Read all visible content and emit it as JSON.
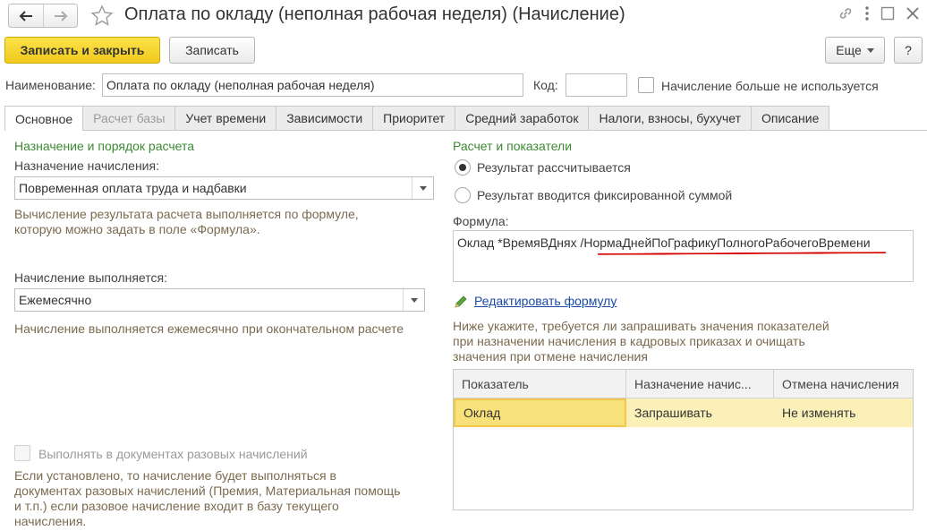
{
  "window": {
    "title": "Оплата по окладу (неполная рабочая неделя) (Начисление)"
  },
  "toolbar": {
    "save_close_label": "Записать и закрыть",
    "save_label": "Записать",
    "more_label": "Еще",
    "help_label": "?"
  },
  "header": {
    "name_label": "Наименование:",
    "name_value": "Оплата по окладу (неполная рабочая неделя)",
    "code_label": "Код:",
    "code_value": "",
    "unused_label": "Начисление больше не используется"
  },
  "tabs": [
    {
      "label": "Основное",
      "state": "active"
    },
    {
      "label": "Расчет базы",
      "state": "disabled"
    },
    {
      "label": "Учет времени",
      "state": "normal"
    },
    {
      "label": "Зависимости",
      "state": "normal"
    },
    {
      "label": "Приоритет",
      "state": "normal"
    },
    {
      "label": "Средний заработок",
      "state": "normal"
    },
    {
      "label": "Налоги, взносы, бухучет",
      "state": "normal"
    },
    {
      "label": "Описание",
      "state": "normal"
    }
  ],
  "left": {
    "section_title": "Назначение и порядок расчета",
    "purpose_label": "Назначение начисления:",
    "purpose_value": "Повременная оплата труда и надбавки",
    "purpose_hint_1": "Вычисление результата расчета выполняется по формуле,",
    "purpose_hint_2": "которую можно задать в поле «Формула».",
    "schedule_label": "Начисление выполняется:",
    "schedule_value": "Ежемесячно",
    "schedule_hint": "Начисление выполняется ежемесячно при окончательном расчете",
    "onetime_label": "Выполнять в документах разовых начислений",
    "onetime_hint_1": "Если установлено, то начисление будет выполняться в",
    "onetime_hint_2": "документах разовых начислений (Премия, Материальная помощь",
    "onetime_hint_3": "и т.п.) если разовое начисление входит в базу текущего",
    "onetime_hint_4": "начисления."
  },
  "right": {
    "section_title": "Расчет и показатели",
    "radio_calculated": "Результат рассчитывается",
    "radio_fixed": "Результат вводится фиксированной суммой",
    "formula_label": "Формула:",
    "formula_value": "Оклад *ВремяВДнях /НормаДнейПоГрафикуПолногоРабочегоВремени",
    "edit_formula_link": "Редактировать формулу",
    "indicators_hint_1": "Ниже укажите, требуется ли запрашивать значения показателей",
    "indicators_hint_2": "при назначении начисления в кадровых приказах и очищать",
    "indicators_hint_3": "значения при отмене начисления",
    "table": {
      "columns": [
        "Показатель",
        "Назначение начис...",
        "Отмена начисления"
      ],
      "rows": [
        [
          "Оклад",
          "Запрашивать",
          "Не изменять"
        ]
      ]
    }
  },
  "colors": {
    "accent_yellow": "#f5d22a",
    "section_green": "#3c8a34",
    "hint_brown": "#7a6a4f",
    "link_blue": "#1a4aa8",
    "selection_row": "#fbf0b8",
    "red_underline": "#d40000"
  }
}
